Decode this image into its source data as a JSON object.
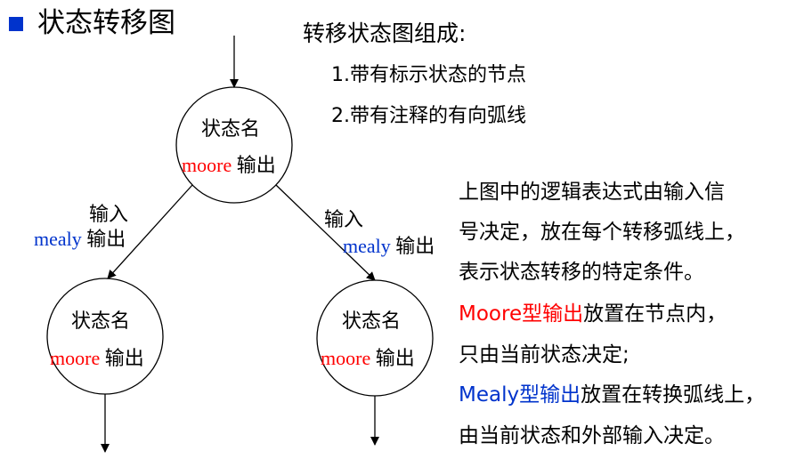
{
  "slide": {
    "title": "状态转移图",
    "bullet_color": "#0033cc"
  },
  "composition": {
    "heading": "转移状态图组成:",
    "items": [
      "1.带有标示状态的节点",
      "2.带有注释的有向弧线"
    ]
  },
  "diagram": {
    "nodes": [
      {
        "id": "top",
        "state_label": "状态名",
        "moore_label": "moore",
        "output_label": "输出"
      },
      {
        "id": "left",
        "state_label": "状态名",
        "moore_label": "moore",
        "output_label": "输出"
      },
      {
        "id": "right",
        "state_label": "状态名",
        "moore_label": "moore",
        "output_label": "输出"
      }
    ],
    "edges": [
      {
        "from": "top",
        "to": "left",
        "input_label": "输入",
        "mealy_label": "mealy",
        "output_label": "输出"
      },
      {
        "from": "top",
        "to": "right",
        "input_label": "输入",
        "mealy_label": "mealy",
        "output_label": "输出"
      }
    ],
    "colors": {
      "moore": "#ff0000",
      "mealy": "#0033cc",
      "line": "#000000"
    }
  },
  "description": {
    "lines": [
      "上图中的逻辑表达式由输入信",
      "号决定，放在每个转移弧线上，",
      "表示状态转移的特定条件。"
    ],
    "moore": {
      "highlight": "Moore型输出",
      "rest": "放置在节点内，"
    },
    "moore_line2": "只由当前状态决定;",
    "mealy": {
      "highlight": "Mealy型输出",
      "rest": "放置在转换弧线上，"
    },
    "mealy_line2": "由当前状态和外部输入决定。"
  }
}
